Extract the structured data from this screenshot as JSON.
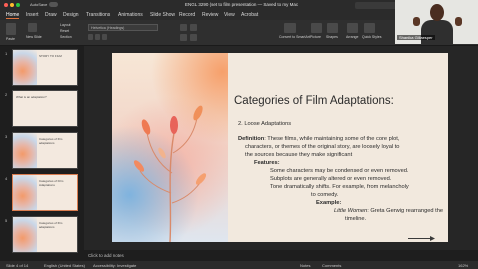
{
  "window": {
    "autosave_label": "AutoSave",
    "doc_title": "ENGL 3290 (set to film presentation — Saved to my Mac"
  },
  "menu": [
    "Home",
    "Insert",
    "Draw",
    "Design",
    "Transitions",
    "Animations",
    "Slide Show",
    "Record",
    "Review",
    "View",
    "Acrobat"
  ],
  "ribbon": {
    "paste": "Paste",
    "new_slide": "New Slide",
    "layout": "Layout",
    "reset": "Reset",
    "section": "Section",
    "font_name": "Helvetica (Headings)",
    "convert": "Convert to SmartArt",
    "picture": "Picture",
    "shapes": "Shapes",
    "arrange": "Arrange",
    "quick_styles": "Quick Styles"
  },
  "thumbnails": [
    {
      "number": "1",
      "text": "STORY TO FILM"
    },
    {
      "number": "2",
      "text": "What is an adaptation?"
    },
    {
      "number": "3",
      "text": "Categories of film adaptations"
    },
    {
      "number": "4",
      "text": "Categories of Film Adaptations"
    },
    {
      "number": "5",
      "text": "Categories of film adaptations"
    }
  ],
  "slide": {
    "title": "Categories of Film Adaptations:",
    "subheading": "2. Loose Adaptations",
    "definition_label": "Definition",
    "definition_text_1": ": These films, while maintaining some of the core plot,",
    "definition_text_2": "characters, or themes of the original story, are loosely loyal to",
    "definition_text_3": "the sources because they make significant",
    "features_label": "Features",
    "feature_1": "Some characters may be condensed or even removed.",
    "feature_2": "Subplots are generally altered or even removed.",
    "feature_3a": "Tone dramatically shifts. For example, from melancholy",
    "feature_3b": "to comedy.",
    "example_label": "Example",
    "example_title": "Little Women",
    "example_text_1": ": Greta Gerwig rearranged the",
    "example_text_2": "timeline."
  },
  "notes_placeholder": "Click to add notes",
  "status": {
    "slide_count": "Slide 4 of 14",
    "language": "English (United States)",
    "accessibility": "Accessibility: Investigate",
    "notes": "Notes",
    "comments": "Comments",
    "zoom": "162%"
  },
  "webcam": {
    "name": "Shanika Gillaesper"
  },
  "colors": {
    "accent": "#e0733e",
    "slide_bg": "#f2e9de"
  }
}
